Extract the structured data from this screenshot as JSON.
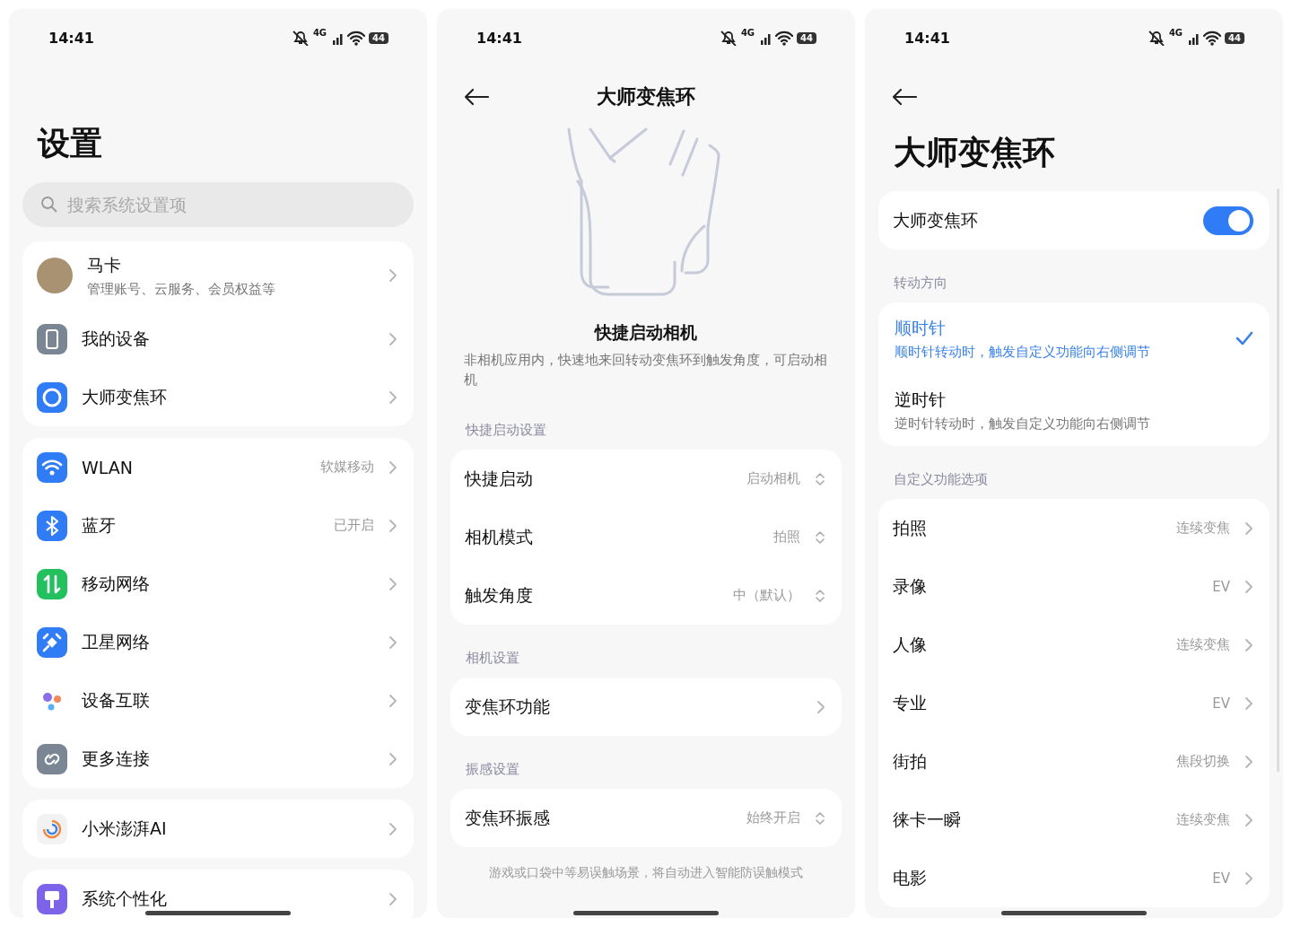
{
  "settings_screen": {
    "status_bar": {
      "time": "14:41",
      "network": "4G",
      "battery": "44"
    },
    "title": "设置",
    "search": {
      "placeholder": "搜索系统设置项"
    },
    "groups": [
      [
        {
          "kind": "account",
          "label": "马卡",
          "subtitle": "管理账号、云服务、会员权益等"
        },
        {
          "kind": "item",
          "label": "我的设备"
        },
        {
          "kind": "item",
          "label": "大师变焦环"
        }
      ],
      [
        {
          "kind": "item",
          "label": "WLAN",
          "value": "软媒移动"
        },
        {
          "kind": "item",
          "label": "蓝牙",
          "value": "已开启"
        },
        {
          "kind": "item",
          "label": "移动网络"
        },
        {
          "kind": "item",
          "label": "卫星网络"
        },
        {
          "kind": "item",
          "label": "设备互联"
        },
        {
          "kind": "item",
          "label": "更多连接"
        }
      ],
      [
        {
          "kind": "item",
          "label": "小米澎湃AI"
        }
      ],
      [
        {
          "kind": "item",
          "label": "系统个性化"
        }
      ]
    ]
  },
  "intro_screen": {
    "status_bar": {
      "time": "14:41",
      "network": "4G",
      "battery": "44"
    },
    "title": "大师变焦环",
    "feature_title": "快捷启动相机",
    "description": "非相机应用内，快速地来回转动变焦环到触发角度，可启动相机",
    "sections": [
      {
        "header": "快捷启动设置",
        "rows": [
          {
            "kind": "picker",
            "label": "快捷启动",
            "value": "启动相机"
          },
          {
            "kind": "picker",
            "label": "相机模式",
            "value": "拍照"
          },
          {
            "kind": "picker",
            "label": "触发角度",
            "value": "中（默认）"
          }
        ]
      },
      {
        "header": "相机设置",
        "rows": [
          {
            "kind": "link",
            "label": "变焦环功能"
          }
        ]
      },
      {
        "header": "振感设置",
        "rows": [
          {
            "kind": "picker",
            "label": "变焦环振感",
            "value": "始终开启"
          }
        ]
      }
    ],
    "footnote": "游戏或口袋中等易误触场景，将自动进入智能防误触模式"
  },
  "ring_screen": {
    "status_bar": {
      "time": "14:41",
      "network": "4G",
      "battery": "44"
    },
    "title": "大师变焦环",
    "toggle": {
      "label": "大师变焦环",
      "on": true
    },
    "direction_header": "转动方向",
    "directions": [
      {
        "title": "顺时针",
        "subtitle": "顺时针转动时，触发自定义功能向右侧调节",
        "selected": true
      },
      {
        "title": "逆时针",
        "subtitle": "逆时针转动时，触发自定义功能向右侧调节",
        "selected": false
      }
    ],
    "function_header": "自定义功能选项",
    "functions": [
      {
        "label": "拍照",
        "value": "连续变焦"
      },
      {
        "label": "录像",
        "value": "EV"
      },
      {
        "label": "人像",
        "value": "连续变焦"
      },
      {
        "label": "专业",
        "value": "EV"
      },
      {
        "label": "街拍",
        "value": "焦段切换"
      },
      {
        "label": "徕卡一瞬",
        "value": "连续变焦"
      },
      {
        "label": "电影",
        "value": "EV"
      }
    ]
  }
}
